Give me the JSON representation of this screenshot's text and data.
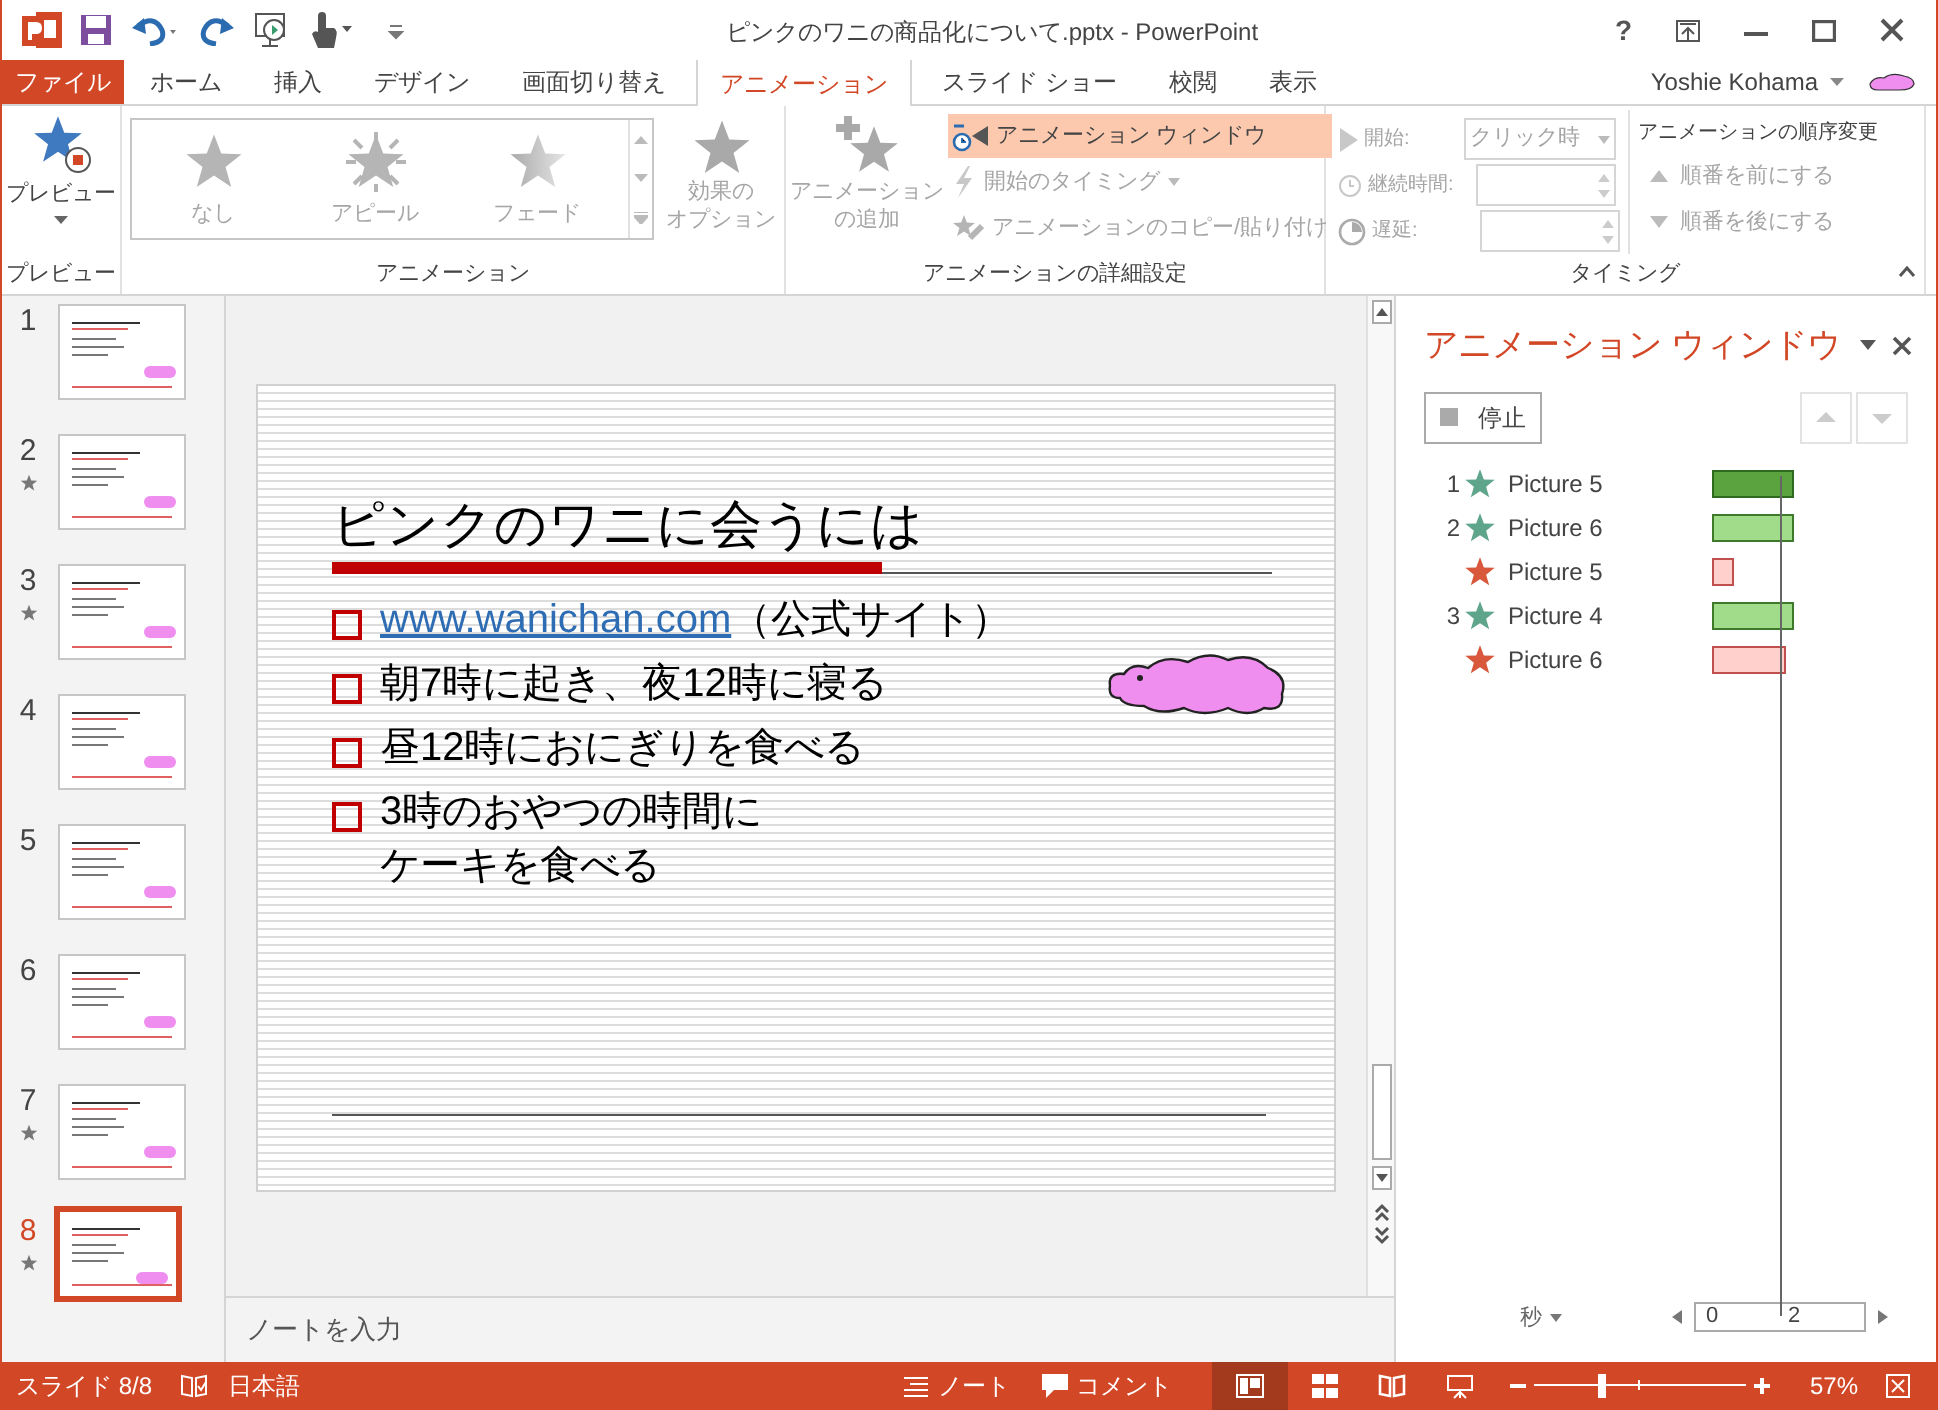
{
  "window": {
    "title": "ピンクのワニの商品化について.pptx - PowerPoint",
    "help": "?"
  },
  "ribbon_tabs": [
    {
      "label": "ファイル",
      "kind": "file",
      "selected": false
    },
    {
      "label": "ホーム",
      "kind": "tab",
      "selected": false
    },
    {
      "label": "挿入",
      "kind": "tab",
      "selected": false
    },
    {
      "label": "デザイン",
      "kind": "tab",
      "selected": false
    },
    {
      "label": "画面切り替え",
      "kind": "tab",
      "selected": false
    },
    {
      "label": "アニメーション",
      "kind": "tab",
      "selected": true
    },
    {
      "label": "スライド ショー",
      "kind": "tab",
      "selected": false
    },
    {
      "label": "校閲",
      "kind": "tab",
      "selected": false
    },
    {
      "label": "表示",
      "kind": "tab",
      "selected": false
    }
  ],
  "account": {
    "name": "Yoshie Kohama"
  },
  "ribbon": {
    "preview": {
      "button": "プレビュー",
      "group_label": "プレビュー"
    },
    "animation": {
      "gallery": [
        {
          "label": "なし",
          "kind": "star"
        },
        {
          "label": "アピール",
          "kind": "burst"
        },
        {
          "label": "フェード",
          "kind": "fade"
        }
      ],
      "effect_options": [
        "効果の",
        "オプション"
      ],
      "group_label": "アニメーション"
    },
    "advanced": {
      "add_animation": [
        "アニメーション",
        "の追加"
      ],
      "commands": [
        {
          "label": "アニメーション ウィンドウ",
          "kind": "pane",
          "selected": true,
          "disabled": false
        },
        {
          "label": "開始のタイミング",
          "kind": "trigger",
          "selected": false,
          "disabled": true
        },
        {
          "label": "アニメーションのコピー/貼り付け",
          "kind": "painter",
          "selected": false,
          "disabled": true
        }
      ],
      "group_label": "アニメーションの詳細設定"
    },
    "timing": {
      "start_label": "開始:",
      "start_value": "クリック時",
      "duration_label": "継続時間:",
      "delay_label": "遅延:",
      "group_label": "タイミング",
      "reorder_title": "アニメーションの順序変更",
      "reorder": [
        {
          "label": "順番を前にする",
          "kind": "up",
          "disabled": true
        },
        {
          "label": "順番を後にする",
          "kind": "down",
          "disabled": true
        }
      ]
    }
  },
  "slides": [
    {
      "number": "1",
      "animated": false,
      "selected": false
    },
    {
      "number": "2",
      "animated": true,
      "selected": false
    },
    {
      "number": "3",
      "animated": true,
      "selected": false
    },
    {
      "number": "4",
      "animated": false,
      "selected": false
    },
    {
      "number": "5",
      "animated": false,
      "selected": false
    },
    {
      "number": "6",
      "animated": false,
      "selected": false
    },
    {
      "number": "7",
      "animated": true,
      "selected": false
    },
    {
      "number": "8",
      "animated": true,
      "selected": true
    }
  ],
  "slide": {
    "title": "ピンクのワニに会うには",
    "bullets": [
      {
        "link": "www.wanichan.com",
        "text": "（公式サイト）"
      },
      {
        "text": "朝7時に起き、夜12時に寝る"
      },
      {
        "text": "昼12時におにぎりを食べる"
      },
      {
        "lines": [
          "3時のおやつの時間に",
          "ケーキを食べる"
        ]
      }
    ]
  },
  "notes": {
    "placeholder": "ノートを入力"
  },
  "animation_pane": {
    "title": "アニメーション ウィンドウ",
    "play_button": "停止",
    "items": [
      {
        "order": "1",
        "kind": "entrance",
        "name": "Picture 5",
        "selected": true
      },
      {
        "order": "2",
        "kind": "entrance",
        "name": "Picture 6",
        "selected": false
      },
      {
        "kind": "exit",
        "name": "Picture 5",
        "selected": false
      },
      {
        "order": "3",
        "kind": "entrance",
        "name": "Picture 4",
        "selected": false
      },
      {
        "kind": "exit",
        "name": "Picture 6",
        "selected": false
      }
    ],
    "time_unit": "秒",
    "scale": [
      "0",
      "2"
    ]
  },
  "status_bar": {
    "slide": "スライド 8/8",
    "language": "日本語",
    "notes": "ノート",
    "comments": "コメント",
    "zoom": {
      "level": 0.32,
      "reading": "57%"
    }
  }
}
